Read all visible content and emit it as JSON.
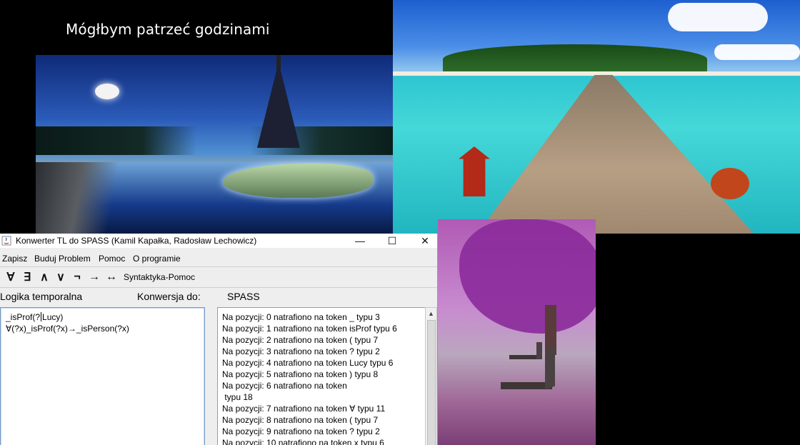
{
  "desktop": {
    "banner_text": "Mógłbym patrzeć godzinami"
  },
  "window": {
    "title": "Konwerter TL do SPASS (Kamil Kapałka, Radosław Lechowicz)",
    "controls": {
      "minimize": "—",
      "maximize": "☐",
      "close": "✕"
    },
    "menu": [
      "Zapisz",
      "Buduj Problem",
      "Pomoc",
      "O programie"
    ],
    "toolbar": {
      "symbols": [
        "∀",
        "∃",
        "∧",
        "∨",
        "¬",
        "→",
        "↔"
      ],
      "help_label": "Syntaktyka-Pomoc"
    },
    "labels": {
      "source": "Logika temporalna",
      "convert_to": "Konwersja do:",
      "target": "SPASS"
    },
    "editor": {
      "line1_before_caret": "_isProf(?",
      "line1_after_caret": "Lucy)",
      "line2": "∀(?x)_isProf(?x)→_isPerson(?x)"
    },
    "output": {
      "lines": [
        "Na pozycji: 0 natrafiono na token _ typu 3",
        "Na pozycji: 1 natrafiono na token isProf typu 6",
        "Na pozycji: 2 natrafiono na token ( typu 7",
        "Na pozycji: 3 natrafiono na token ? typu 2",
        "Na pozycji: 4 natrafiono na token Lucy typu 6",
        "Na pozycji: 5 natrafiono na token ) typu 8",
        "Na pozycji: 6 natrafiono na token",
        " typu 18",
        "Na pozycji: 7 natrafiono na token ∀ typu 11",
        "Na pozycji: 8 natrafiono na token ( typu 7",
        "Na pozycji: 9 natrafiono na token ? typu 2",
        "Na pozycji: 10 natrafiono na token x typu 6"
      ]
    }
  }
}
